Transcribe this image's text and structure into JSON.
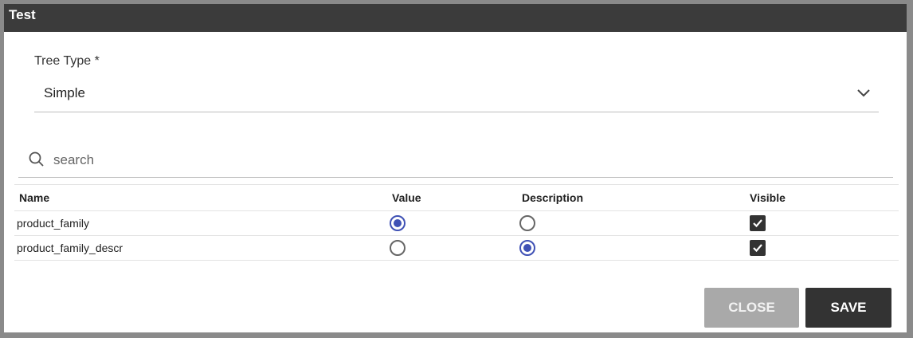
{
  "dialog": {
    "title": "Test"
  },
  "tree_type": {
    "label": "Tree Type *",
    "value": "Simple"
  },
  "search": {
    "placeholder": "search",
    "value": ""
  },
  "table": {
    "headers": {
      "name": "Name",
      "value": "Value",
      "description": "Description",
      "visible": "Visible"
    },
    "rows": [
      {
        "name": "product_family",
        "value_selected": true,
        "description_selected": false,
        "visible": true
      },
      {
        "name": "product_family_descr",
        "value_selected": false,
        "description_selected": true,
        "visible": true
      }
    ]
  },
  "buttons": {
    "close": "CLOSE",
    "save": "SAVE"
  },
  "colors": {
    "accent": "#3f51b5",
    "titlebar": "#3b3b3b",
    "save": "#333333",
    "close": "#a9a9a9"
  },
  "icons": {
    "dropdown": "chevron-down-icon",
    "search": "search-icon",
    "checkbox": "check-icon"
  }
}
